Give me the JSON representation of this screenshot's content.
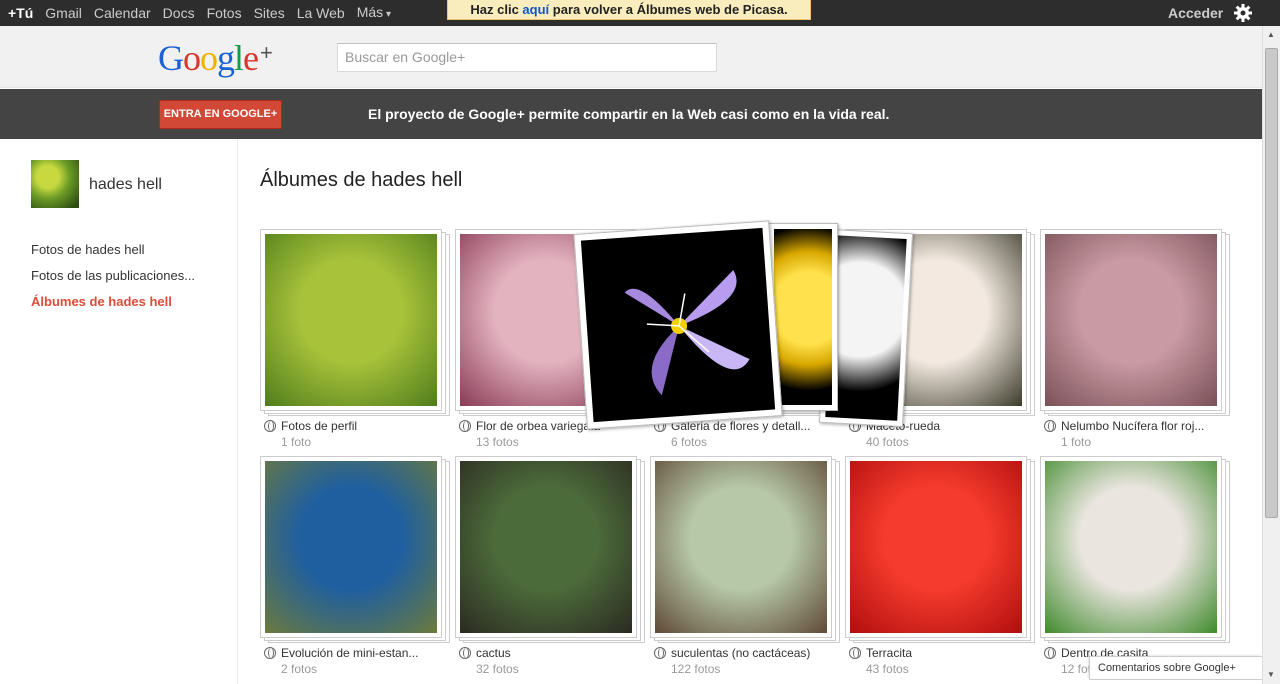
{
  "topnav": {
    "items": [
      "+Tú",
      "Gmail",
      "Calendar",
      "Docs",
      "Fotos",
      "Sites",
      "La Web",
      "Más"
    ],
    "notice_before": "Haz clic ",
    "notice_link": "aquí",
    "notice_after": " para volver a Álbumes web de Picasa.",
    "signin": "Acceder"
  },
  "header": {
    "logo": "Google",
    "logo_plus": "+",
    "search_placeholder": "Buscar en Google+"
  },
  "promo": {
    "button": "ENTRA EN GOOGLE+",
    "text": "El proyecto de Google+ permite compartir en la Web casi como en la vida real."
  },
  "sidebar": {
    "user_name": "hades hell",
    "links": [
      "Fotos de hades hell",
      "Fotos de las publicaciones...",
      "Álbumes de hades hell"
    ]
  },
  "main": {
    "title": "Álbumes de hades hell",
    "albums": [
      {
        "name": "Fotos de perfil",
        "count": "1 foto",
        "colors": [
          "#a8c23a",
          "#4f7d1c"
        ]
      },
      {
        "name": "Flor de orbea variegata",
        "count": "13 fotos",
        "colors": [
          "#e3b3c0",
          "#8a3a55"
        ]
      },
      {
        "name": "Galeria de flores y detall...",
        "count": "6 fotos",
        "colors": [
          "#000000",
          "#9b7fd1"
        ]
      },
      {
        "name": "Maceto-rueda",
        "count": "40 fotos",
        "colors": [
          "#f3e9e0",
          "#3b3b2b"
        ]
      },
      {
        "name": "Nelumbo Nucífera flor roj...",
        "count": "1 foto",
        "colors": [
          "#c99aa3",
          "#7a5057"
        ]
      },
      {
        "name": "Evolución de mini-estan...",
        "count": "2 fotos",
        "colors": [
          "#1f5fa0",
          "#6c7a3c"
        ]
      },
      {
        "name": "cactus",
        "count": "32 fotos",
        "colors": [
          "#4c6b3a",
          "#2b2a22"
        ]
      },
      {
        "name": "suculentas (no cactáceas)",
        "count": "122 fotos",
        "colors": [
          "#b6c8a8",
          "#5f4936"
        ]
      },
      {
        "name": "Terracita",
        "count": "43 fotos",
        "colors": [
          "#f53b2d",
          "#b00e0e"
        ]
      },
      {
        "name": "Dentro de casita",
        "count": "12 fotos",
        "colors": [
          "#eae5df",
          "#3f8a2c"
        ]
      }
    ]
  },
  "feedback": "Comentarios sobre Google+"
}
